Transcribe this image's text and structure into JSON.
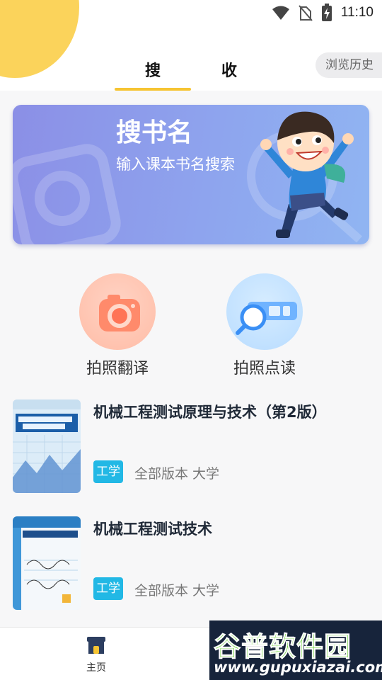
{
  "status_bar": {
    "time": "11:10",
    "icons": [
      "wifi-icon",
      "no-sim-icon",
      "battery-charging-icon"
    ]
  },
  "tabs": [
    {
      "label": "搜",
      "active": true
    },
    {
      "label": "收",
      "active": false
    }
  ],
  "history_button": "浏览历史",
  "banner": {
    "title": "搜书名",
    "subtitle": "输入课本书名搜索"
  },
  "features": [
    {
      "label": "拍照翻译",
      "icon": "camera-icon"
    },
    {
      "label": "拍照点读",
      "icon": "magnifier-scan-icon"
    }
  ],
  "books": [
    {
      "title": "机械工程测试原理与技术（第2版）",
      "tag": "工学",
      "meta": "全部版本 大学"
    },
    {
      "title": "机械工程测试技术",
      "tag": "工学",
      "meta": "全部版本 大学"
    }
  ],
  "bottom_nav": {
    "home_label": "主页"
  },
  "watermark": {
    "title": "谷普软件园",
    "url": "www.gupuxiazai.com"
  },
  "colors": {
    "accent": "#f6c432",
    "banner": "#8b8fe6",
    "tag": "#22b8e5"
  }
}
